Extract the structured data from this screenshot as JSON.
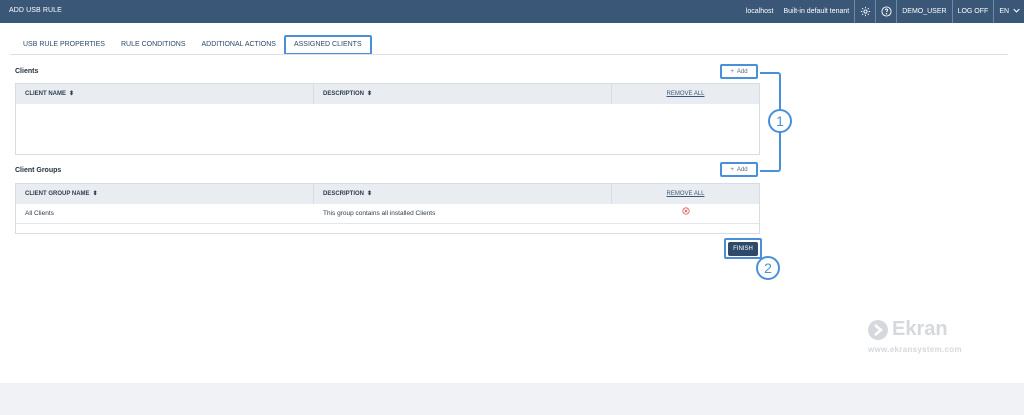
{
  "window": {
    "title": "ADD USB RULE"
  },
  "topbar": {
    "host": "localhost",
    "tenant": "Built-in default tenant",
    "user": "DEMO_USER",
    "logoff": "LOG OFF",
    "language": "EN",
    "icons": [
      "gear-icon",
      "help-icon",
      "chevron-down-icon"
    ]
  },
  "tabs": [
    {
      "label": "USB RULE PROPERTIES"
    },
    {
      "label": "RULE CONDITIONS"
    },
    {
      "label": "ADDITIONAL ACTIONS"
    },
    {
      "label": "ASSIGNED CLIENTS",
      "active": true
    }
  ],
  "clients": {
    "title": "Clients",
    "add_label": "Add",
    "columns": [
      "CLIENT NAME",
      "DESCRIPTION",
      "REMOVE ALL"
    ],
    "rows": []
  },
  "client_groups": {
    "title": "Client Groups",
    "add_label": "Add",
    "columns": [
      "CLIENT GROUP NAME",
      "DESCRIPTION",
      "REMOVE ALL"
    ],
    "rows": [
      {
        "name": "All Clients",
        "description": "This group contains all installed Clients"
      }
    ]
  },
  "finish_label": "FINISH",
  "callouts": [
    "1",
    "2"
  ],
  "watermark": {
    "brand": "Ekran",
    "url": "www.ekransystem.com"
  },
  "colors": {
    "header": "#3a5778",
    "accent": "#4a90d9",
    "finish": "#2f4a68",
    "remove": "#e05252"
  }
}
